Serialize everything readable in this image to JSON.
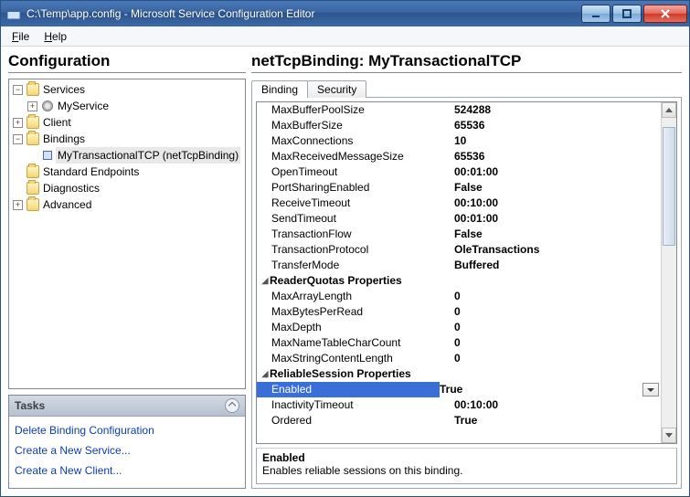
{
  "window": {
    "title": "C:\\Temp\\app.config - Microsoft Service Configuration Editor"
  },
  "menu": {
    "file": "File",
    "help": "Help"
  },
  "config": {
    "heading": "Configuration",
    "tree": {
      "services": "Services",
      "myservice": "MyService",
      "client": "Client",
      "bindings": "Bindings",
      "binding_item": "MyTransactionalTCP (netTcpBinding)",
      "standard_endpoints": "Standard Endpoints",
      "diagnostics": "Diagnostics",
      "advanced": "Advanced"
    }
  },
  "tasks": {
    "heading": "Tasks",
    "delete_binding": "Delete Binding Configuration",
    "new_service": "Create a New Service...",
    "new_client": "Create a New Client..."
  },
  "right": {
    "heading": "netTcpBinding: MyTransactionalTCP",
    "tabs": {
      "binding": "Binding",
      "security": "Security"
    },
    "grid": [
      {
        "name": "MaxBufferPoolSize",
        "value": "524288"
      },
      {
        "name": "MaxBufferSize",
        "value": "65536"
      },
      {
        "name": "MaxConnections",
        "value": "10"
      },
      {
        "name": "MaxReceivedMessageSize",
        "value": "65536"
      },
      {
        "name": "OpenTimeout",
        "value": "00:01:00"
      },
      {
        "name": "PortSharingEnabled",
        "value": "False"
      },
      {
        "name": "ReceiveTimeout",
        "value": "00:10:00"
      },
      {
        "name": "SendTimeout",
        "value": "00:01:00"
      },
      {
        "name": "TransactionFlow",
        "value": "False"
      },
      {
        "name": "TransactionProtocol",
        "value": "OleTransactions"
      },
      {
        "name": "TransferMode",
        "value": "Buffered"
      }
    ],
    "cat_reader": "ReaderQuotas Properties",
    "reader": [
      {
        "name": "MaxArrayLength",
        "value": "0"
      },
      {
        "name": "MaxBytesPerRead",
        "value": "0"
      },
      {
        "name": "MaxDepth",
        "value": "0"
      },
      {
        "name": "MaxNameTableCharCount",
        "value": "0"
      },
      {
        "name": "MaxStringContentLength",
        "value": "0"
      }
    ],
    "cat_reliable": "ReliableSession Properties",
    "reliable": [
      {
        "name": "Enabled",
        "value": "True",
        "selected": true
      },
      {
        "name": "InactivityTimeout",
        "value": "00:10:00"
      },
      {
        "name": "Ordered",
        "value": "True"
      }
    ],
    "help": {
      "title": "Enabled",
      "text": "Enables reliable sessions on this binding."
    }
  }
}
